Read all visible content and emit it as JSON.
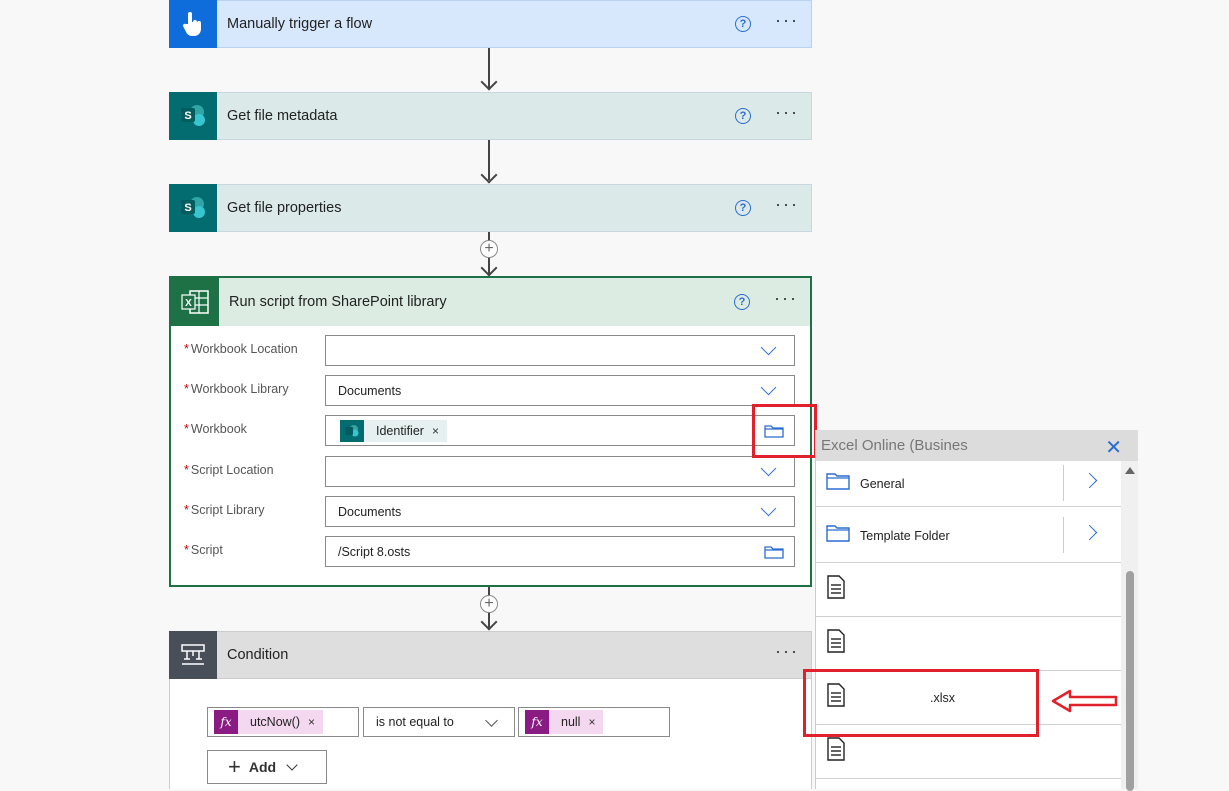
{
  "flow": {
    "trigger": {
      "title": "Manually trigger a flow"
    },
    "step1": {
      "title": "Get file metadata"
    },
    "step2": {
      "title": "Get file properties"
    },
    "run_script": {
      "title": "Run script from SharePoint library",
      "fields": [
        {
          "label": "Workbook Location",
          "value": ""
        },
        {
          "label": "Workbook Library",
          "value": "Documents"
        },
        {
          "label": "Workbook",
          "token": "Identifier"
        },
        {
          "label": "Script Location",
          "value": ""
        },
        {
          "label": "Script Library",
          "value": "Documents"
        },
        {
          "label": "Script",
          "value": "/Script 8.osts"
        }
      ]
    },
    "condition": {
      "title": "Condition",
      "left_token": "utcNow()",
      "operator": "is not equal to",
      "right_token": "null",
      "add_label": "Add",
      "fx_label": "fx"
    }
  },
  "picker": {
    "title": "Excel Online (Busines",
    "folders": [
      {
        "label": "General"
      },
      {
        "label": "Template Folder"
      }
    ],
    "files": [
      {
        "label": ""
      },
      {
        "label": ""
      },
      {
        "label": ".xlsx"
      },
      {
        "label": ""
      }
    ]
  },
  "common": {
    "help": "?",
    "more": "···",
    "sharepoint_letter": "S"
  },
  "colors": {
    "trigger_bg": "#d8e8fc",
    "trigger_icon": "#0f6cdb",
    "sharepoint_bg": "#dbe9e9",
    "sharepoint_icon": "#036c70",
    "excel_header": "#dcece2",
    "excel_icon": "#1e7145",
    "condition_header": "#dedede",
    "condition_icon": "#484f58",
    "highlight": "#e0202a"
  }
}
